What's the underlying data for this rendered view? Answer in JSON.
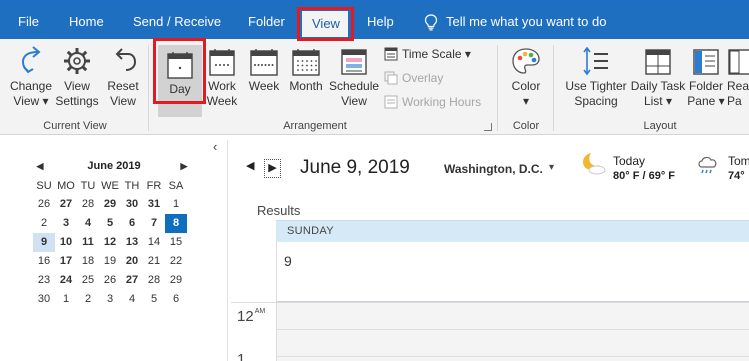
{
  "tabs": {
    "file": "File",
    "home": "Home",
    "send_receive": "Send / Receive",
    "folder": "Folder",
    "view": "View",
    "help": "Help",
    "tell_me": "Tell me what you want to do"
  },
  "ribbon": {
    "current_view": {
      "change_view": [
        "Change",
        "View"
      ],
      "view_settings": [
        "View",
        "Settings"
      ],
      "reset_view": [
        "Reset",
        "View"
      ],
      "group_label": "Current View"
    },
    "arrangement": {
      "day": "Day",
      "work_week": [
        "Work",
        "Week"
      ],
      "week": "Week",
      "month": "Month",
      "schedule_view": [
        "Schedule",
        "View"
      ],
      "time_scale": "Time Scale",
      "overlay": "Overlay",
      "working_hours": "Working Hours",
      "group_label": "Arrangement"
    },
    "color": {
      "color": "Color",
      "group_label": "Color"
    },
    "layout": {
      "use_tighter_spacing": [
        "Use Tighter",
        "Spacing"
      ],
      "daily_task_list": [
        "Daily Task",
        "List"
      ],
      "folder_pane": [
        "Folder",
        "Pane"
      ],
      "reading_pane": [
        "Rea",
        "Pa"
      ],
      "group_label": "Layout"
    }
  },
  "mini_calendar": {
    "month_label": "June 2019",
    "weekdays": [
      "SU",
      "MO",
      "TU",
      "WE",
      "TH",
      "FR",
      "SA"
    ],
    "weeks": [
      [
        "26",
        "27",
        "28",
        "29",
        "30",
        "31",
        "1"
      ],
      [
        "2",
        "3",
        "4",
        "5",
        "6",
        "7",
        "8"
      ],
      [
        "9",
        "10",
        "11",
        "12",
        "13",
        "14",
        "15"
      ],
      [
        "16",
        "17",
        "18",
        "19",
        "20",
        "21",
        "22"
      ],
      [
        "23",
        "24",
        "25",
        "26",
        "27",
        "28",
        "29"
      ],
      [
        "30",
        "1",
        "2",
        "3",
        "4",
        "5",
        "6"
      ]
    ],
    "bold_days": [
      "27",
      "29",
      "30",
      "3",
      "5",
      "6",
      "9",
      "10",
      "11",
      "12",
      "13",
      "17",
      "20",
      "24",
      "27b"
    ],
    "selected_day": "9",
    "today": "8"
  },
  "calendar": {
    "date_title": "June 9, 2019",
    "location": "Washington,  D.C.",
    "weather_today": {
      "label": "Today",
      "temps": "80° F / 69° F"
    },
    "weather_tomorrow": {
      "label": "Tom",
      "temps": "74°"
    },
    "results_label": "Results",
    "day_name": "SUNDAY",
    "day_number": "9",
    "hour_label": "12",
    "hour_suffix": "AM",
    "next_hour_label": "1"
  },
  "colors": {
    "accent": "#1f6fc1",
    "highlight": "#e01b24",
    "today_fill": "#106ebe",
    "selected_fill": "#cfe1f3",
    "day_header": "#d5e9f7"
  }
}
